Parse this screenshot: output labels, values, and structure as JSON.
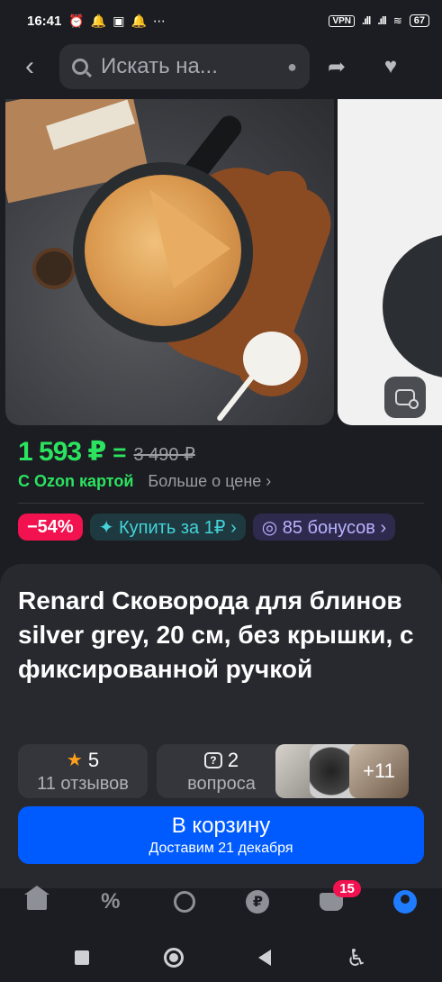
{
  "status_bar": {
    "time": "16:41",
    "vpn": "VPN",
    "battery": "67"
  },
  "top_nav": {
    "search_placeholder": "Искать на..."
  },
  "price": {
    "current": "1 593 ₽",
    "old": "3 490 ₽",
    "ozon_card": "С Ozon картой",
    "more": "Больше о цене ›"
  },
  "chips": {
    "discount": "−54%",
    "buy_for": "✦ Купить за 1₽ ›",
    "bonus": "◎ 85 бонусов ›"
  },
  "product": {
    "title": "Renard Сковорода для блинов silver grey, 20 см, без крышки, с фиксированной ручкой"
  },
  "stats": {
    "rating": "5",
    "reviews": "11 отзывов",
    "questions_count": "2",
    "questions": "вопроса",
    "more_photos": "+11"
  },
  "cart_button": {
    "label": "В корзину",
    "delivery": "Доставим 21 декабря"
  },
  "tab_bar": {
    "cart_badge": "15"
  },
  "colors": {
    "accent_green": "#2be35f",
    "brand_blue": "#005bff",
    "discount_red": "#f1124f"
  }
}
